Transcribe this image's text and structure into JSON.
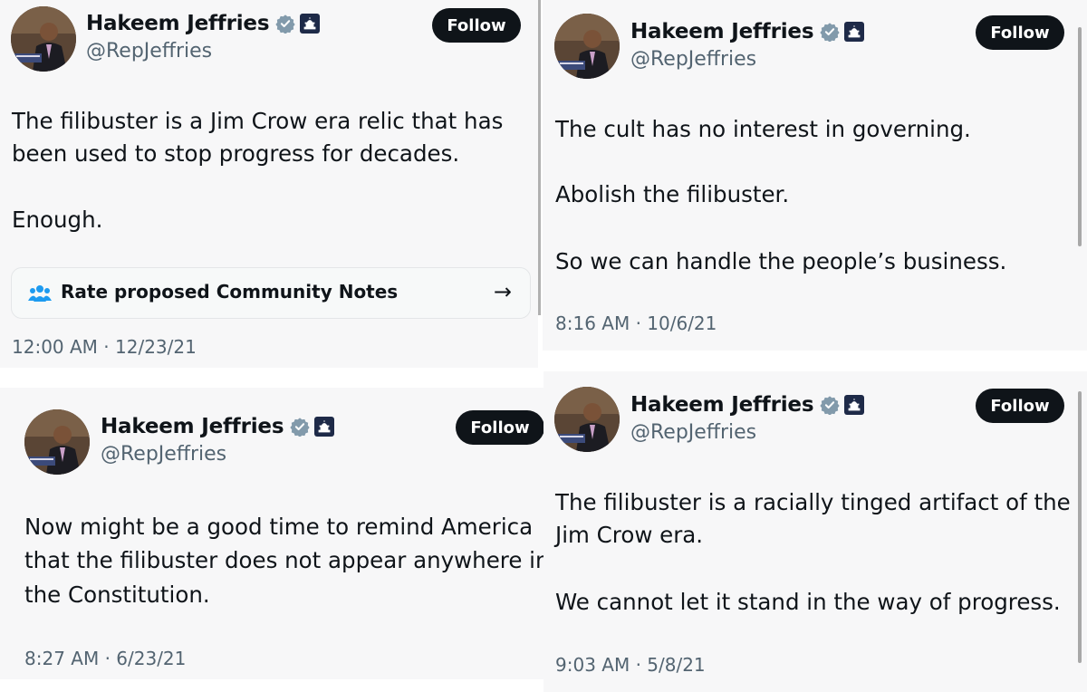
{
  "tweets": [
    {
      "name": "Hakeem Jeffries",
      "handle": "@RepJeffries",
      "follow_label": "Follow",
      "paragraphs": [
        "The filibuster is a Jim Crow era relic that has",
        "been used to stop progress for decades.",
        "Enough."
      ],
      "community_notes": {
        "label": "Rate proposed Community Notes",
        "arrow": "→"
      },
      "timestamp": "12:00 AM · 12/23/21"
    },
    {
      "name": "Hakeem Jeffries",
      "handle": "@RepJeffries",
      "follow_label": "Follow",
      "paragraphs": [
        "The cult has no interest in governing.",
        "Abolish the filibuster.",
        "So we can handle the people’s business."
      ],
      "timestamp": "8:16 AM · 10/6/21"
    },
    {
      "name": "Hakeem Jeffries",
      "handle": "@RepJeffries",
      "follow_label": "Follow",
      "paragraphs": [
        "Now might be a good time to remind America",
        "that the filibuster does not appear anywhere in",
        "the Constitution."
      ],
      "timestamp": "8:27 AM · 6/23/21"
    },
    {
      "name": "Hakeem Jeffries",
      "handle": "@RepJeffries",
      "follow_label": "Follow",
      "paragraphs": [
        "The filibuster is a racially tinged artifact of the",
        "Jim Crow era.",
        "We cannot let it stand in the way of progress."
      ],
      "timestamp": "9:03 AM · 5/8/21"
    }
  ],
  "icons": {
    "verified": "verified-badge-icon",
    "affiliation": "capitol-affiliation-icon",
    "notes": "community-notes-icon"
  },
  "colors": {
    "verified_badge": "#829aab",
    "follow_bg": "#0f1419",
    "notes_icon": "#1d9bf0",
    "muted_text": "#536471"
  }
}
